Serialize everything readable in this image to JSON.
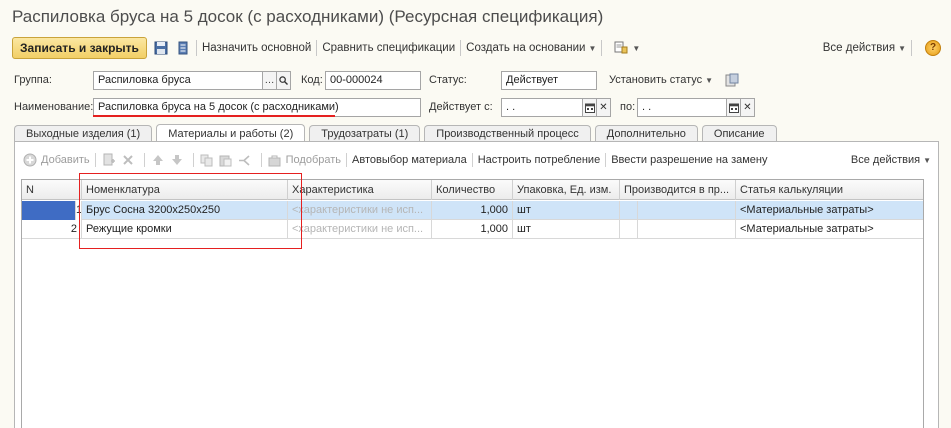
{
  "window": {
    "title": "Распиловка бруса на 5 досок (с расходниками) (Ресурсная спецификация)"
  },
  "toolbar": {
    "save_close": "Записать и закрыть",
    "set_main": "Назначить основной",
    "compare": "Сравнить спецификации",
    "create_based": "Создать на основании",
    "all_actions": "Все действия",
    "help": "?"
  },
  "form": {
    "group_label": "Группа:",
    "group_value": "Распиловка бруса",
    "code_label": "Код:",
    "code_value": "00-000024",
    "status_label": "Статус:",
    "status_value": "Действует",
    "set_status": "Установить статус",
    "name_label": "Наименование:",
    "name_value": "Распиловка бруса на 5 досок (с расходниками)",
    "valid_from_label": "Действует с:",
    "valid_from_value": ". .",
    "valid_to_label": "по:",
    "valid_to_value": ". ."
  },
  "tabs": [
    {
      "label": "Выходные изделия (1)"
    },
    {
      "label": "Материалы и работы (2)",
      "active": true
    },
    {
      "label": "Трудозатраты (1)"
    },
    {
      "label": "Производственный процесс"
    },
    {
      "label": "Дополнительно"
    },
    {
      "label": "Описание"
    }
  ],
  "materials_toolbar": {
    "add": "Добавить",
    "pick": "Подобрать",
    "auto_select": "Автовыбор материала",
    "configure": "Настроить потребление",
    "replace": "Ввести разрешение на замену",
    "all_actions": "Все действия"
  },
  "table": {
    "columns": [
      "N",
      "Номенклатура",
      "Характеристика",
      "Количество",
      "Упаковка, Ед. изм.",
      "Производится в пр...",
      "Статья калькуляции"
    ],
    "rows": [
      {
        "n": "1",
        "item": "Брус Сосна 3200х250х250",
        "characteristic": "<характеристики не исп...",
        "qty": "1,000",
        "unit": "шт",
        "produced": "",
        "article": "<Материальные затраты>"
      },
      {
        "n": "2",
        "item": "Режущие кромки",
        "characteristic": "<характеристики не исп...",
        "qty": "1,000",
        "unit": "шт",
        "produced": "",
        "article": "<Материальные затраты>"
      }
    ]
  },
  "colors": {
    "primary_button": "#f2cf66",
    "selected_row": "#cfe4f8",
    "annotation_red": "#e52020"
  }
}
